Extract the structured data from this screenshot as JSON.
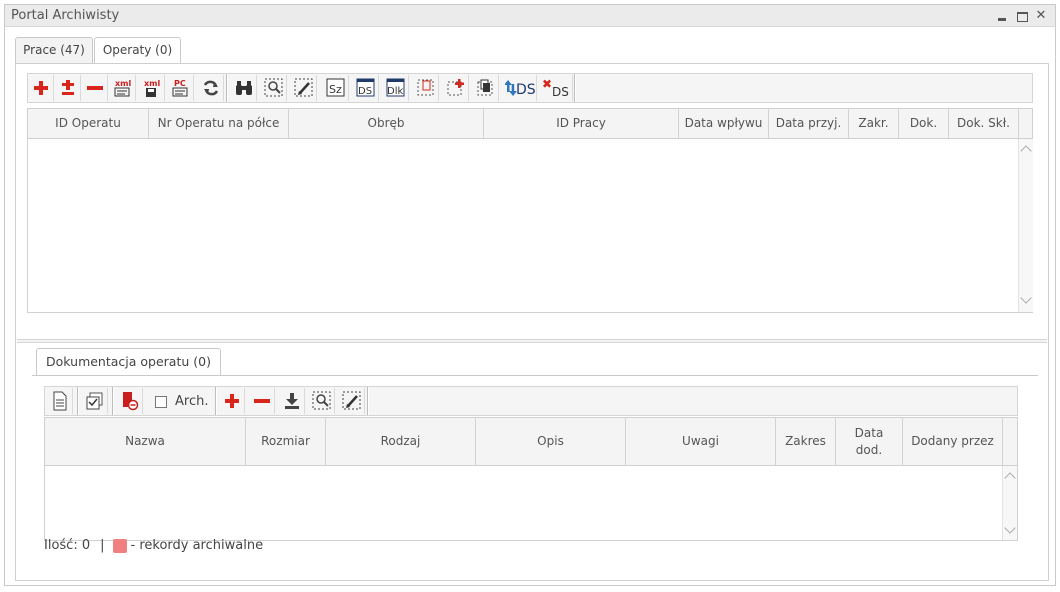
{
  "window": {
    "title": "Portal Archiwisty"
  },
  "tabs": [
    {
      "label": "Prace (47)",
      "active": false
    },
    {
      "label": "Operaty (0)",
      "active": true
    }
  ],
  "operaty_toolbar": [
    "add-icon",
    "add-remove-icon",
    "remove-icon",
    "xml-export-icon",
    "xml-import-icon",
    "pdf-export-icon",
    "refresh-icon",
    "binoculars-icon",
    "zoom-select-icon",
    "edit-select-icon",
    "sz-icon",
    "ds-icon",
    "dlk-icon",
    "ds-select-icon",
    "add-select-icon",
    "copy-select-icon",
    "sync-ds-icon",
    "remove-ds-icon"
  ],
  "operaty_toolbar_text": {
    "sz": "Sz",
    "ds": "DS",
    "dlk": "Dlk",
    "sync_ds": "DS",
    "remove_ds": "DS"
  },
  "operaty_grid": {
    "columns": [
      "ID Operatu",
      "Nr Operatu na półce",
      "Obręb",
      "ID Pracy",
      "Data wpływu",
      "Data przyj.",
      "Zakr.",
      "Dok.",
      "Dok. Skł."
    ],
    "rows": []
  },
  "dok_tab": {
    "label": "Dokumentacja operatu (0)"
  },
  "dok_toolbar": {
    "arch_label": "Arch.",
    "arch_checked": false
  },
  "dok_grid": {
    "columns": [
      "Nazwa",
      "Rozmiar",
      "Rodzaj",
      "Opis",
      "Uwagi",
      "Zakres",
      "Data dod.",
      "Dodany przez"
    ],
    "rows": []
  },
  "footer": {
    "count": "Ilość: 0",
    "separator": "|",
    "legend": "- rekordy archiwalne"
  },
  "colors": {
    "archive_swatch": "#f08080",
    "icon_red": "#d9261c",
    "icon_navy": "#1f3a6b"
  }
}
